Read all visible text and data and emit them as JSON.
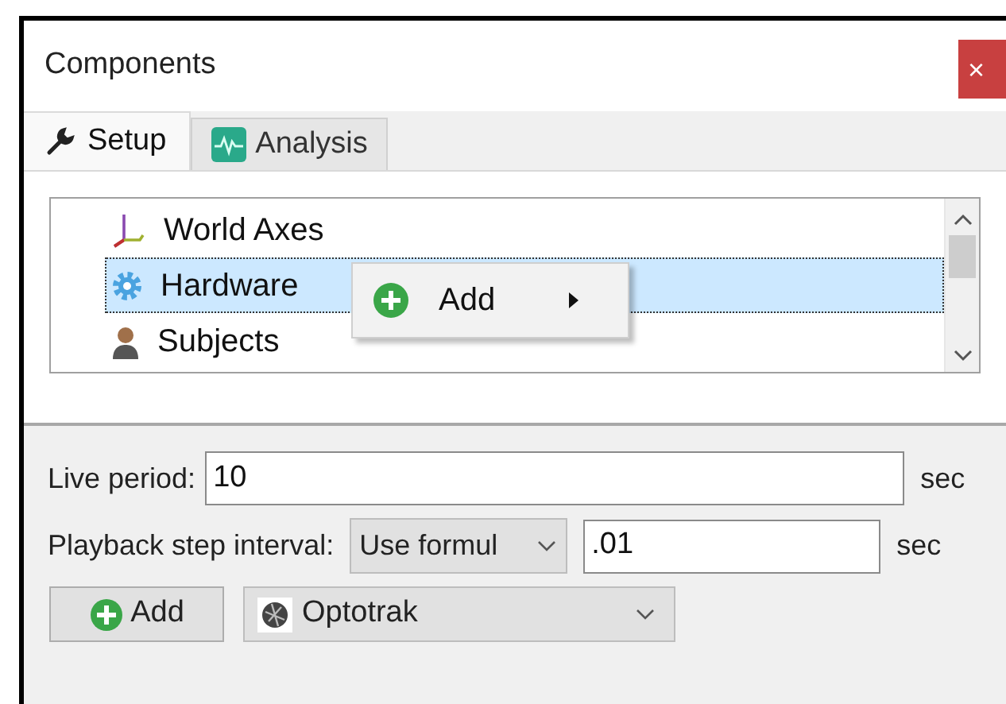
{
  "window": {
    "title": "Components",
    "close": "×"
  },
  "tabs": [
    {
      "label": "Setup",
      "selected": true
    },
    {
      "label": "Analysis",
      "selected": false
    }
  ],
  "tree": {
    "items": [
      {
        "label": "World Axes",
        "selected": false
      },
      {
        "label": "Hardware",
        "selected": true
      },
      {
        "label": "Subjects",
        "selected": false
      }
    ]
  },
  "context_menu": {
    "items": [
      {
        "label": "Add",
        "has_submenu": true
      }
    ]
  },
  "live_period": {
    "label": "Live period:",
    "value": "10",
    "unit": "sec"
  },
  "playback": {
    "label": "Playback step interval:",
    "mode": "Use formul",
    "value": ".01",
    "unit": "sec"
  },
  "add_button": {
    "label": "Add"
  },
  "device": {
    "value": "Optotrak"
  }
}
